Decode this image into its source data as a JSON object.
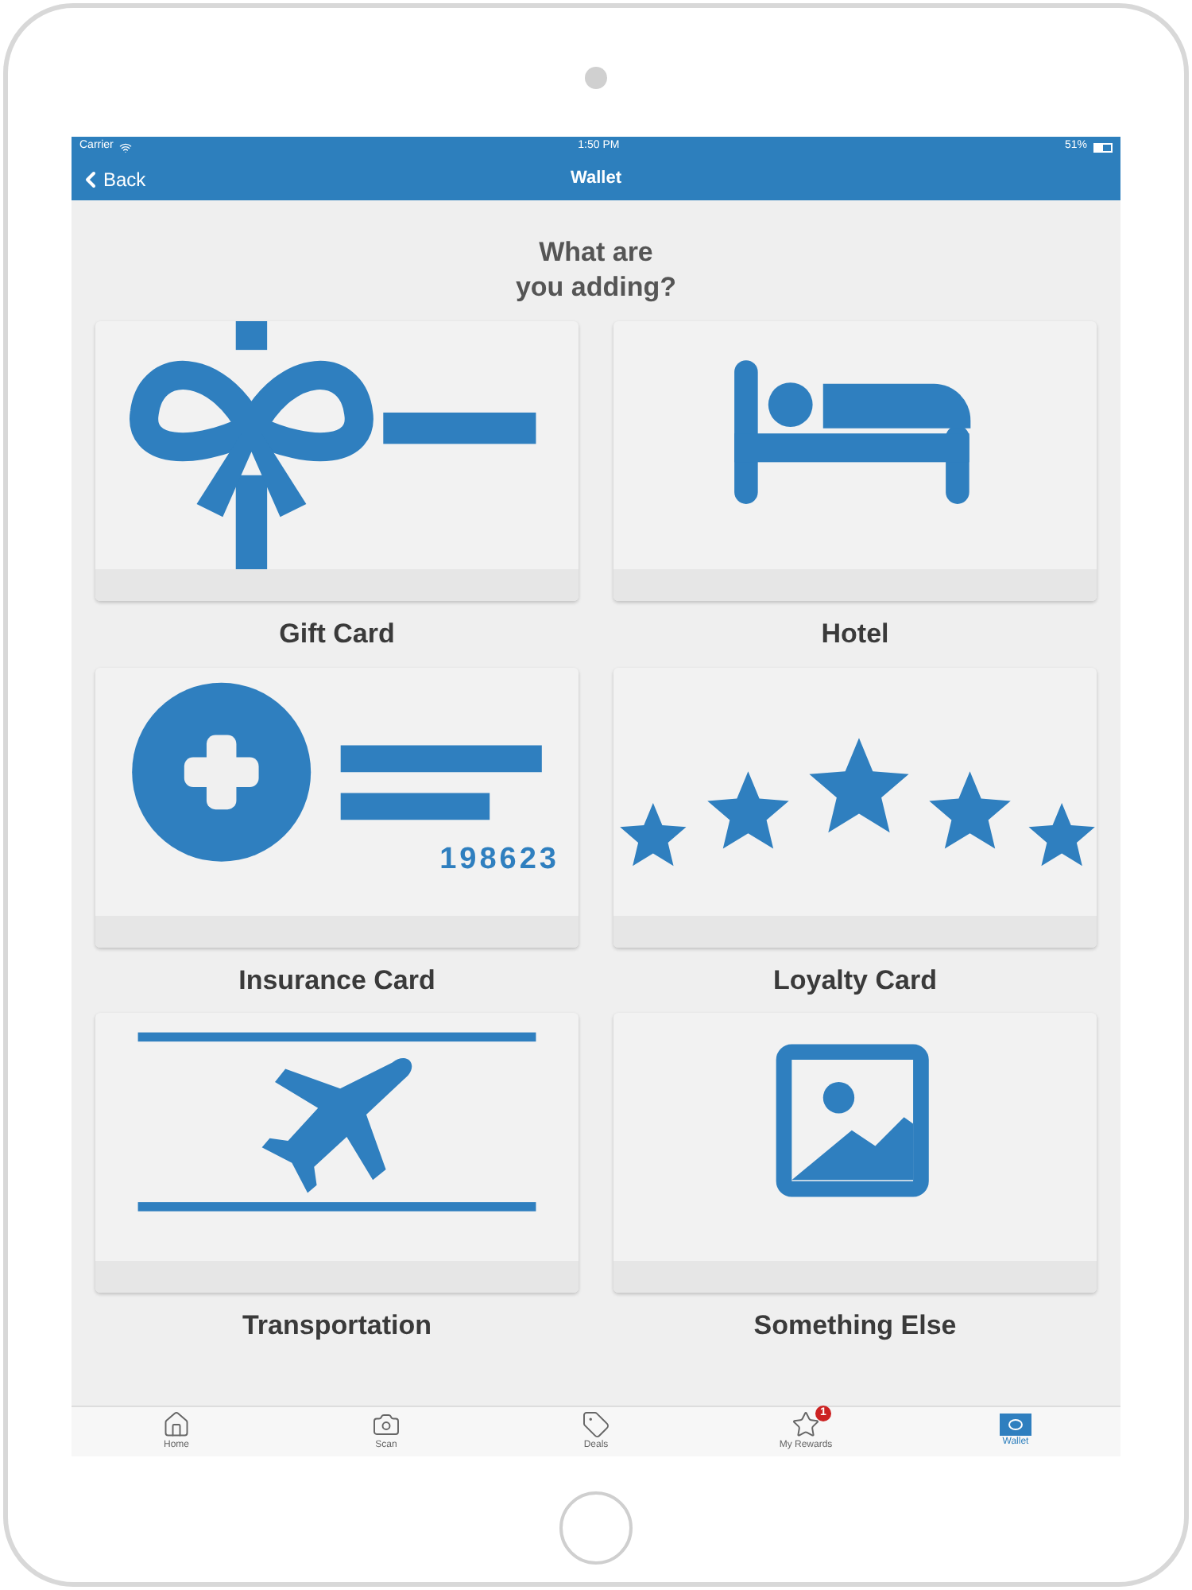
{
  "status_bar": {
    "carrier": "Carrier",
    "time": "1:50 PM",
    "battery": "51%"
  },
  "nav": {
    "back": "Back",
    "title": "Wallet"
  },
  "heading": "What are\nyou adding?",
  "cards": [
    {
      "kind": "gift",
      "label": "Gift Card"
    },
    {
      "kind": "hotel",
      "label": "Hotel"
    },
    {
      "kind": "insurance",
      "label": "Insurance Card",
      "number": "198623"
    },
    {
      "kind": "loyalty",
      "label": "Loyalty Card"
    },
    {
      "kind": "transport",
      "label": "Transportation"
    },
    {
      "kind": "picture",
      "label": "Something Else"
    }
  ],
  "tabs": [
    {
      "kind": "home",
      "label": "Home",
      "selected": false
    },
    {
      "kind": "camera",
      "label": "Scan",
      "selected": false
    },
    {
      "kind": "tag",
      "label": "Deals",
      "selected": false
    },
    {
      "kind": "star",
      "label": "My Rewards",
      "selected": false,
      "badge": "1"
    },
    {
      "kind": "wallet",
      "label": "Wallet",
      "selected": true
    }
  ]
}
